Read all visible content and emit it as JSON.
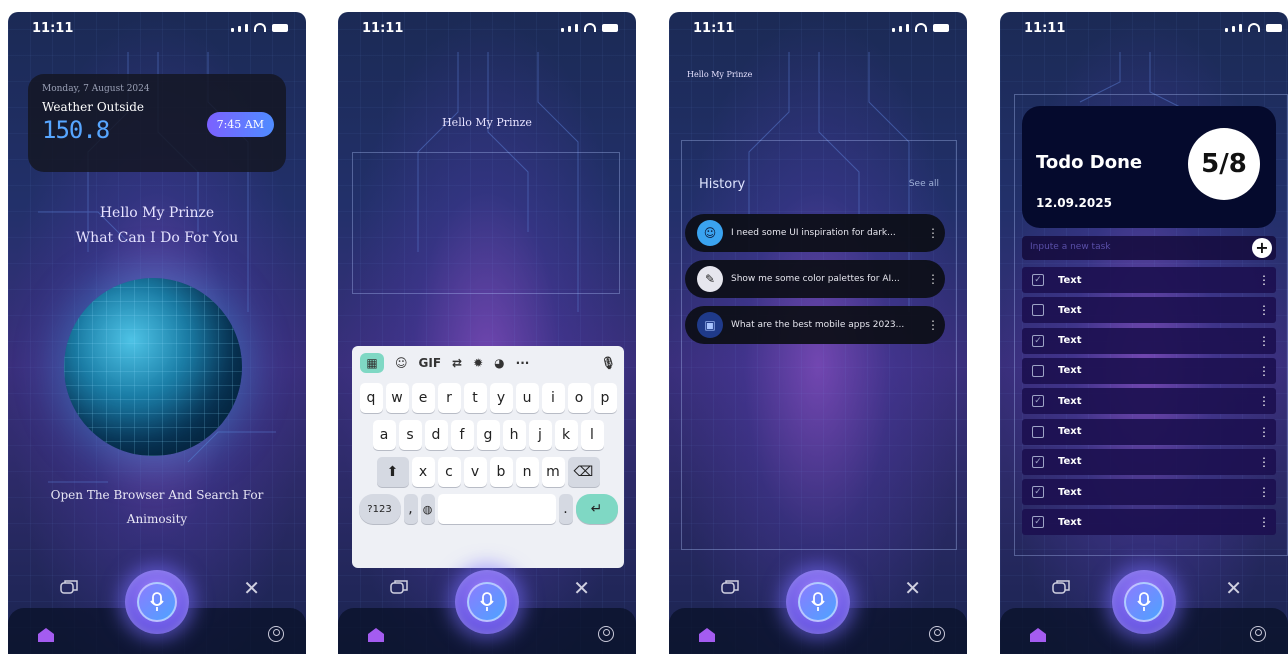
{
  "status": {
    "time": "11:11"
  },
  "screen1": {
    "date": "Monday, 7 August 2024",
    "weather_title": "Weather Outside",
    "weather_value": "150.8",
    "time_badge": "7:45 AM",
    "greeting": "Hello My Prinze",
    "question": "What Can I Do For You",
    "caption_line1": "Open The Browser And Search For",
    "caption_line2": "Animosity"
  },
  "screen2": {
    "greeting": "Hello My Prinze",
    "toolbar": [
      "GIF",
      "···"
    ],
    "row1": [
      "q",
      "w",
      "e",
      "r",
      "t",
      "y",
      "u",
      "i",
      "o",
      "p"
    ],
    "row2": [
      "a",
      "s",
      "d",
      "f",
      "g",
      "h",
      "j",
      "k",
      "l"
    ],
    "row3": [
      "x",
      "c",
      "v",
      "b",
      "n",
      "m"
    ],
    "mode_key": "?123",
    "comma_key": ",",
    "period_key": "."
  },
  "screen3": {
    "greeting": "Hello My Prinze",
    "history_title": "History",
    "see_all": "See all",
    "items": [
      "I need some UI inspiration for dark...",
      "Show me some color palettes for AI...",
      "What are the best mobile apps 2023..."
    ]
  },
  "screen4": {
    "title": "Todo Done",
    "count": "5/8",
    "date": "12.09.2025",
    "new_task_placeholder": "Inpute a new task",
    "tasks": [
      {
        "label": "Text",
        "checked": true
      },
      {
        "label": "Text",
        "checked": false
      },
      {
        "label": "Text",
        "checked": true
      },
      {
        "label": "Text",
        "checked": false
      },
      {
        "label": "Text",
        "checked": true
      },
      {
        "label": "Text",
        "checked": false
      },
      {
        "label": "Text",
        "checked": true
      },
      {
        "label": "Text",
        "checked": true
      },
      {
        "label": "Text",
        "checked": true
      }
    ]
  },
  "icons": [
    "chat-icon",
    "mic-icon",
    "close-icon",
    "home-icon",
    "profile-icon",
    "signal-icon",
    "wifi-icon",
    "battery-icon",
    "plus-icon",
    "checkbox-icon",
    "more-vertical-icon"
  ],
  "colors": {
    "accent": "#7b61ff",
    "weather_value": "#57a6ff",
    "keyboard_green": "#7fd8c4",
    "todo_card": "#050a2d"
  }
}
